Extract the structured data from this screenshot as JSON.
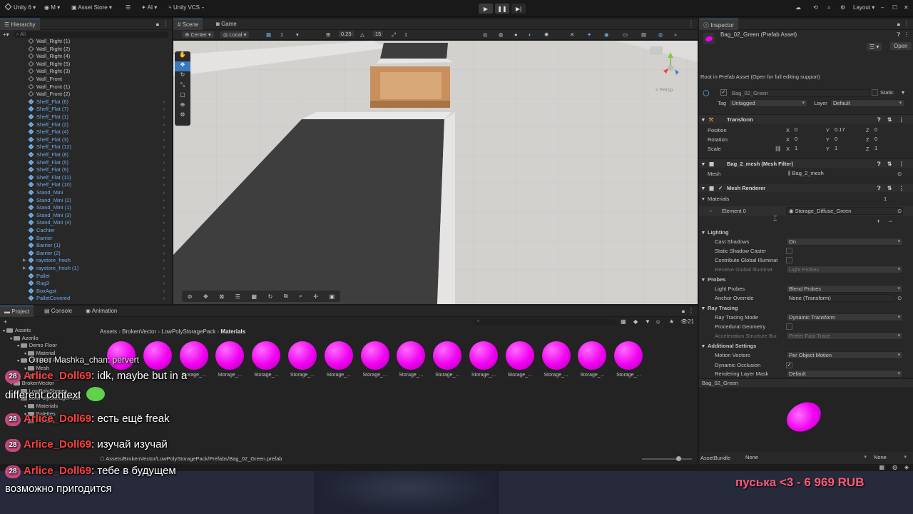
{
  "toolbar": {
    "account": "Unity 6",
    "user_initial": "M",
    "asset_store": "Asset Store",
    "ai": "AI",
    "vcs": "Unity VCS",
    "layout": "Layout"
  },
  "hierarchy": {
    "title": "Hierarchy",
    "search_placeholder": "All",
    "items": [
      {
        "label": "Wall_Right (1)",
        "prefab": false
      },
      {
        "label": "Wall_Right (2)",
        "prefab": false
      },
      {
        "label": "Wall_Right (4)",
        "prefab": false
      },
      {
        "label": "Wall_Right (5)",
        "prefab": false
      },
      {
        "label": "Wall_Right (3)",
        "prefab": false
      },
      {
        "label": "Wall_Front",
        "prefab": false
      },
      {
        "label": "Wall_Front (1)",
        "prefab": false
      },
      {
        "label": "Wall_Front (2)",
        "prefab": false
      },
      {
        "label": "Shelf_Flat (6)",
        "prefab": true
      },
      {
        "label": "Shelf_Flat (7)",
        "prefab": true
      },
      {
        "label": "Shelf_Flat (1)",
        "prefab": true
      },
      {
        "label": "Shelf_Flat (2)",
        "prefab": true
      },
      {
        "label": "Shelf_Flat (4)",
        "prefab": true
      },
      {
        "label": "Shelf_Flat (3)",
        "prefab": true
      },
      {
        "label": "Shelf_Flat (12)",
        "prefab": true
      },
      {
        "label": "Shelf_Flat (8)",
        "prefab": true
      },
      {
        "label": "Shelf_Flat (5)",
        "prefab": true
      },
      {
        "label": "Shelf_Flat (9)",
        "prefab": true
      },
      {
        "label": "Shelf_Flat (11)",
        "prefab": true
      },
      {
        "label": "Shelf_Flat (10)",
        "prefab": true
      },
      {
        "label": "Stand_Mini",
        "prefab": true
      },
      {
        "label": "Stand_Mini (2)",
        "prefab": true
      },
      {
        "label": "Stand_Mini (1)",
        "prefab": true
      },
      {
        "label": "Stand_Mini (3)",
        "prefab": true
      },
      {
        "label": "Stand_Mini (4)",
        "prefab": true
      },
      {
        "label": "Cachier",
        "prefab": true
      },
      {
        "label": "Barrier",
        "prefab": true
      },
      {
        "label": "Barrier (1)",
        "prefab": true
      },
      {
        "label": "Barrier (2)",
        "prefab": true
      },
      {
        "label": "raystore_fresh",
        "prefab": true
      },
      {
        "label": "raystore_fresh (1)",
        "prefab": true
      },
      {
        "label": "Pallet",
        "prefab": true
      },
      {
        "label": "Rug3",
        "prefab": true
      },
      {
        "label": "BoxAgst",
        "prefab": true
      },
      {
        "label": "PalletCovered",
        "prefab": true
      }
    ]
  },
  "scene": {
    "tab_scene": "Scene",
    "tab_game": "Game",
    "pivot": "Center",
    "space": "Local",
    "grid_value": "1",
    "snap_value": "0.25",
    "angle_value": "15",
    "scale_value": "1",
    "persp_label": "< Persp"
  },
  "inspector": {
    "title": "Inspector",
    "asset_title": "Bag_02_Green (Prefab Asset)",
    "open_button": "Open",
    "root_note": "Root in Prefab Asset (Open for full editing support)",
    "object_name": "Bag_02_Green",
    "static_label": "Static",
    "tag_label": "Tag",
    "tag_value": "Untagged",
    "layer_label": "Layer",
    "layer_value": "Default",
    "transform": {
      "title": "Transform",
      "position_label": "Position",
      "rotation_label": "Rotation",
      "scale_label": "Scale",
      "position": {
        "x": "0",
        "y": "0.17",
        "z": "0"
      },
      "rotation": {
        "x": "0",
        "y": "0",
        "z": "0"
      },
      "scale": {
        "x": "1",
        "y": "1",
        "z": "1"
      }
    },
    "mesh_filter": {
      "title": "Bag_2_mesh (Mesh Filter)",
      "mesh_label": "Mesh",
      "mesh_value": "Bag_2_mesh"
    },
    "mesh_renderer": {
      "title": "Mesh Renderer",
      "materials_label": "Materials",
      "materials_count": "1",
      "element_label": "Element 0",
      "element_value": "Storage_Diffuse_Green",
      "lighting_label": "Lighting",
      "cast_shadows_label": "Cast Shadows",
      "cast_shadows_value": "On",
      "static_caster_label": "Static Shadow Caster",
      "contribute_gi_label": "Contribute Global Illuminat",
      "receive_gi_label": "Receive Global Illuminat",
      "receive_gi_value": "Light Probes",
      "probes_label": "Probes",
      "light_probes_label": "Light Probes",
      "light_probes_value": "Blend Probes",
      "anchor_label": "Anchor Override",
      "anchor_value": "None (Transform)",
      "ray_tracing_label": "Ray Tracing",
      "ray_mode_label": "Ray Tracing Mode",
      "ray_mode_value": "Dynamic Transform",
      "procedural_label": "Procedural Geometry",
      "accel_label": "Acceleration Structure Bui",
      "accel_value": "Prefer Fast Trace",
      "additional_label": "Additional Settings",
      "motion_label": "Motion Vectors",
      "motion_value": "Per Object Motion",
      "occlusion_label": "Dynamic Occlusion",
      "render_layer_label": "Rendering Layer Mask",
      "render_layer_value": "Default"
    },
    "preview_title": "Bag_02_Green",
    "assetbundle_label": "AssetBundle",
    "assetbundle_value": "None",
    "assetbundle_variant": "None"
  },
  "project": {
    "tab_project": "Project",
    "tab_console": "Console",
    "tab_animation": "Animation",
    "breadcrumb": [
      "Assets",
      "BrokenVector",
      "LowPolyStoragePack",
      "Materials"
    ],
    "count": "21",
    "tree": [
      {
        "label": "Assets",
        "indent": 0
      },
      {
        "label": "Azerilo",
        "indent": 1
      },
      {
        "label": "Demo Floor",
        "indent": 2
      },
      {
        "label": "Material",
        "indent": 3
      },
      {
        "label": "Free Rug Pack",
        "indent": 2
      },
      {
        "label": "Mesh",
        "indent": 3
      },
      {
        "label": "Scene",
        "indent": 3
      },
      {
        "label": "BrokenVector",
        "indent": 1
      },
      {
        "label": "LowPolyShapes",
        "indent": 2
      },
      {
        "label": "LowPolyStoragePack",
        "indent": 2
      },
      {
        "label": "Materials",
        "indent": 3
      },
      {
        "label": "Palettes",
        "indent": 3
      },
      {
        "label": "Prefabs",
        "indent": 3
      }
    ],
    "items": [
      {
        "label": ""
      },
      {
        "label": ""
      },
      {
        "label": "Storage_..."
      },
      {
        "label": "Storage_..."
      },
      {
        "label": "Storage_..."
      },
      {
        "label": "Storage_..."
      },
      {
        "label": "Storage_..."
      },
      {
        "label": "Storage_..."
      },
      {
        "label": "Storage_..."
      },
      {
        "label": "Storage_..."
      },
      {
        "label": "Storage_..."
      },
      {
        "label": "Storage_..."
      },
      {
        "label": "Storage_..."
      },
      {
        "label": "Storage_..."
      },
      {
        "label": "Storage_..."
      }
    ],
    "path": "Assets/BrokenVector/LowPolyStoragePack/Prefabs/Bag_02_Green.prefab"
  },
  "chat": {
    "reply": "Ответ Mashka_chan: pervert",
    "messages": [
      {
        "badge": "28",
        "name": "Arlice_Doll69",
        "text": ": idk, maybe but in a"
      },
      {
        "badge": "",
        "name": "",
        "text": "different context"
      },
      {
        "badge": "28",
        "name": "Arlice_Doll69",
        "text": ": есть ещё freak"
      },
      {
        "badge": "28",
        "name": "Arlice_Doll69",
        "text": ": изучай изучай"
      },
      {
        "badge": "28",
        "name": "Arlice_Doll69",
        "text": ": тебе в будущем"
      },
      {
        "badge": "",
        "name": "",
        "text": "возможно пригодится"
      }
    ],
    "donation": "пуська <3 - 6 969 RUB"
  },
  "colors": {
    "accent": "#3a79bb",
    "prefab_blue": "#6fa9e6",
    "material_magenta": "#f000f0",
    "chat_name": "#ff4040",
    "donation": "#ff5a7a"
  }
}
